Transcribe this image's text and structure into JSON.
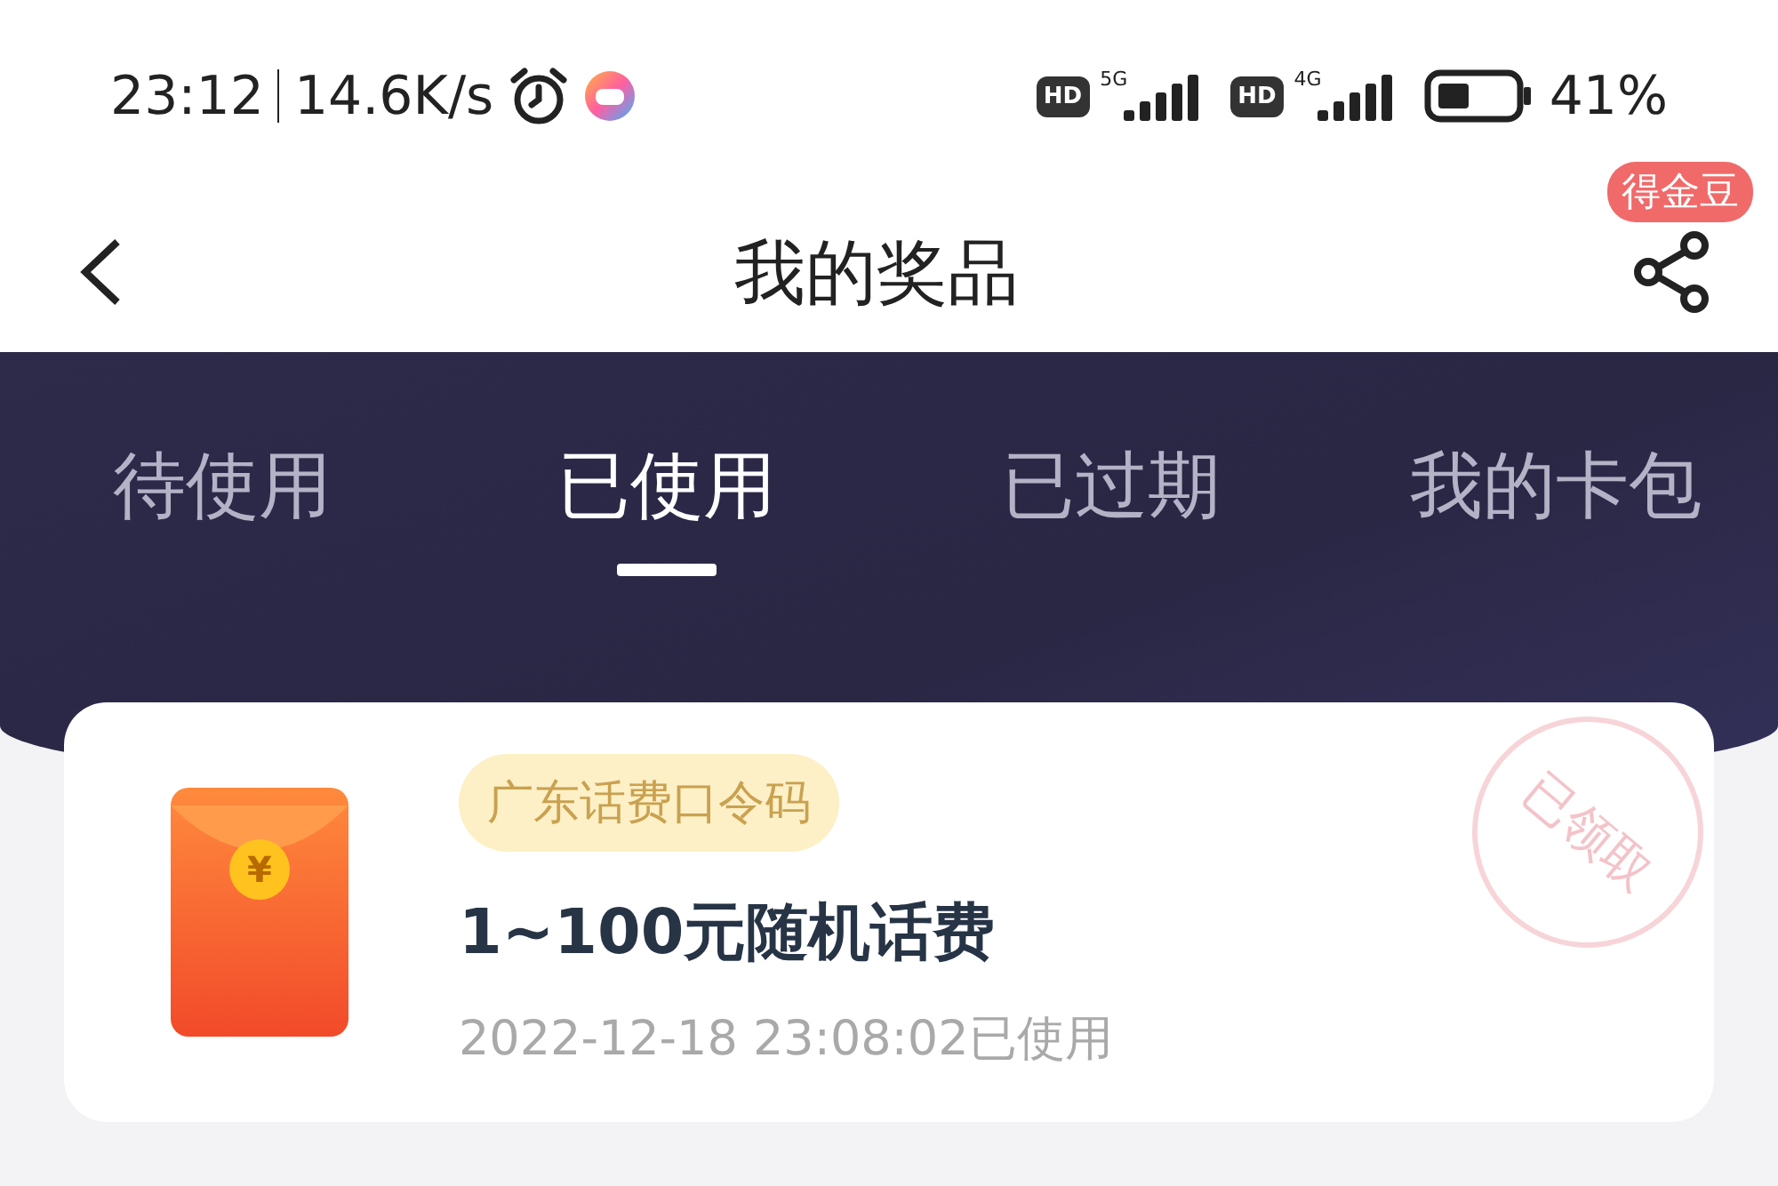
{
  "status_bar": {
    "time": "23:12",
    "speed": "14.6K/s",
    "sims": [
      {
        "badge": "HD",
        "network": "5G"
      },
      {
        "badge": "HD",
        "network": "4G"
      }
    ],
    "battery": "41%"
  },
  "header": {
    "title": "我的奖品",
    "badge": "得金豆"
  },
  "tabs": [
    {
      "label": "待使用",
      "selected": false
    },
    {
      "label": "已使用",
      "selected": true
    },
    {
      "label": "已过期",
      "selected": false
    },
    {
      "label": "我的卡包",
      "selected": false
    }
  ],
  "prizes": [
    {
      "currency": "¥",
      "tag": "广东话费口令码",
      "title": "1~100元随机话费",
      "used_at": "2022-12-18 23:08:02已使用",
      "stamp": "已领取"
    }
  ]
}
